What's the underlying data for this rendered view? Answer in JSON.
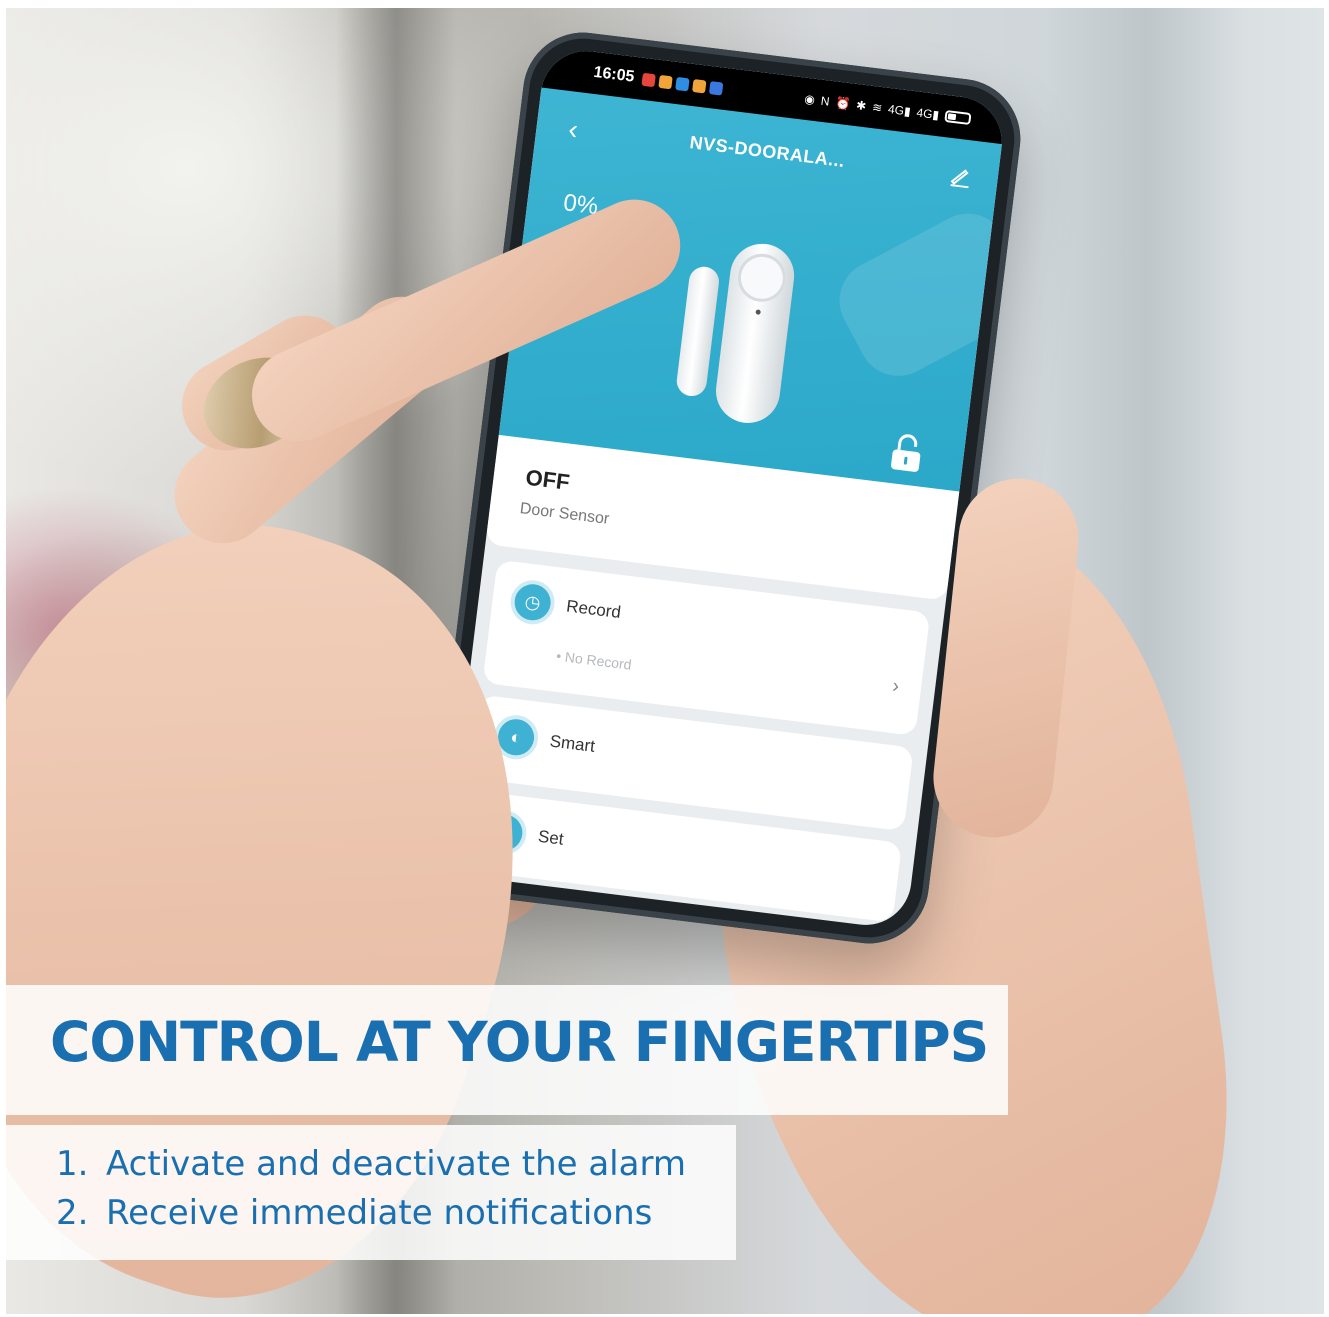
{
  "phone": {
    "status_bar": {
      "time": "16:05",
      "app_icon_colors": [
        "#e8463c",
        "#f0a43a",
        "#2f8de4",
        "#f0a43a",
        "#3a78e0"
      ],
      "icons": [
        "eye-icon",
        "nfc-icon",
        "alarm-icon",
        "bluetooth-icon",
        "wifi-icon",
        "signal-icon",
        "signal-icon",
        "battery-icon"
      ],
      "net1": "4G",
      "net2": "4G"
    },
    "header": {
      "title": "NVS-DOORALA..."
    },
    "battery_percent": "0%",
    "device_state": {
      "status": "OFF",
      "type": "Door Sensor"
    },
    "menu": {
      "record": {
        "label": "Record",
        "sub": "No Record"
      },
      "smart": {
        "label": "Smart"
      },
      "set": {
        "label": "Set"
      }
    },
    "accent_color": "#3fb1d2"
  },
  "caption": {
    "headline": "CONTROL AT YOUR FINGERTIPS",
    "points": [
      {
        "num": "1.",
        "text": "Activate and deactivate the alarm"
      },
      {
        "num": "2.",
        "text": "Receive immediate notifications"
      }
    ],
    "text_color": "#1a6fb0"
  }
}
